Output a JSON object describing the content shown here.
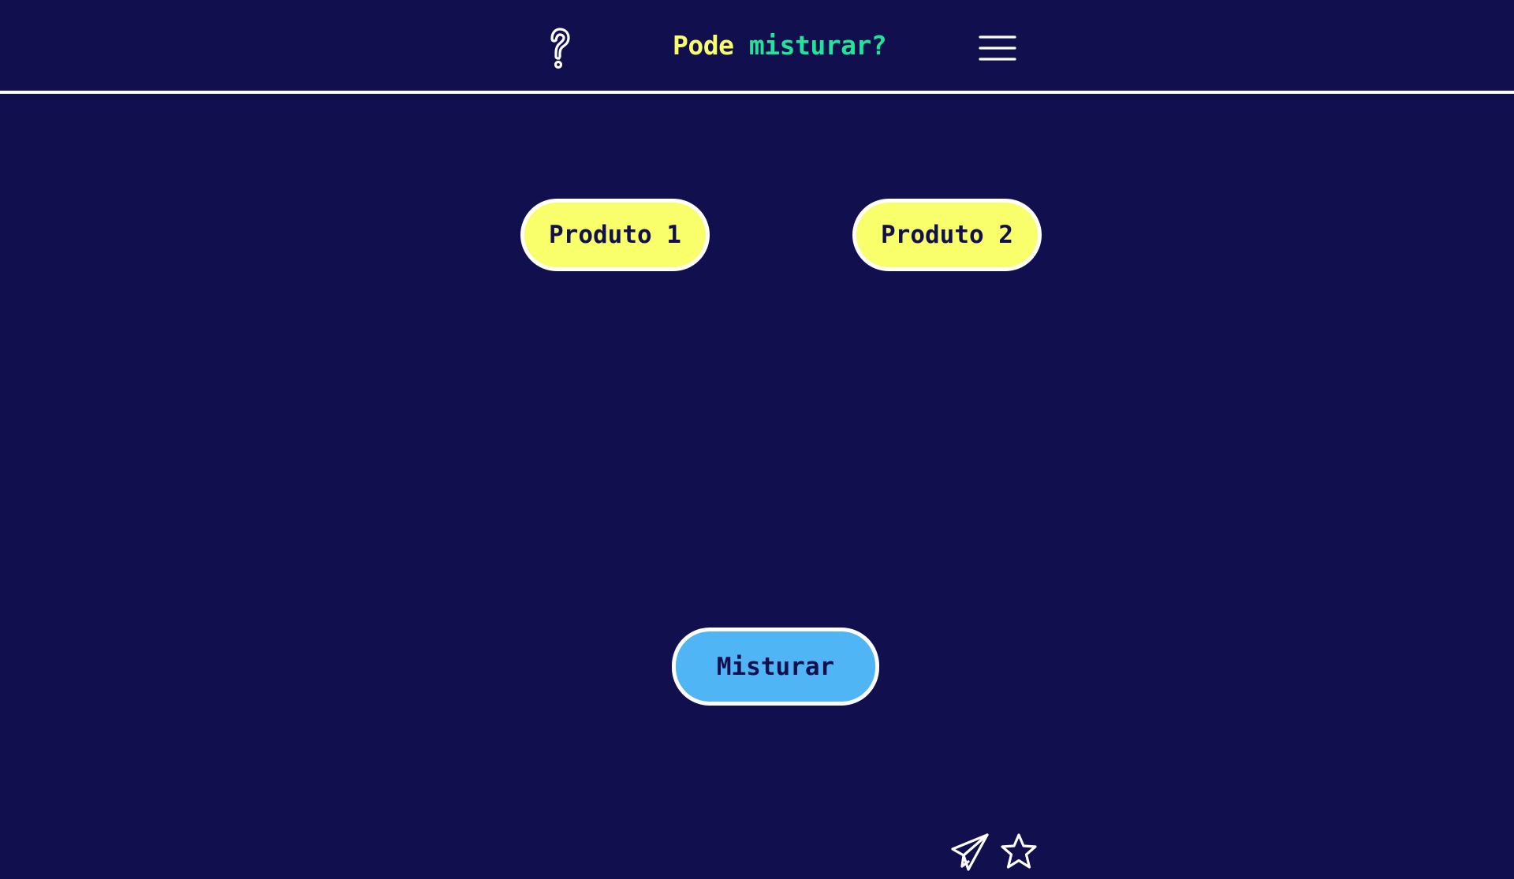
{
  "header": {
    "title_part1": "Pode",
    "title_part2": "misturar?",
    "help_icon": "question-mark-icon",
    "menu_icon": "hamburger-menu-icon"
  },
  "products": {
    "product1_label": "Produto 1",
    "product2_label": "Produto 2"
  },
  "actions": {
    "mix_label": "Misturar"
  },
  "footer": {
    "share_icon": "paper-plane-icon",
    "favorite_icon": "star-icon"
  },
  "colors": {
    "background": "#110f4e",
    "title_primary": "#f9ff6b",
    "title_accent": "#22e39a",
    "product_button": "#f9ff6b",
    "mix_button": "#4fb5f5",
    "outline": "#ffffff"
  }
}
